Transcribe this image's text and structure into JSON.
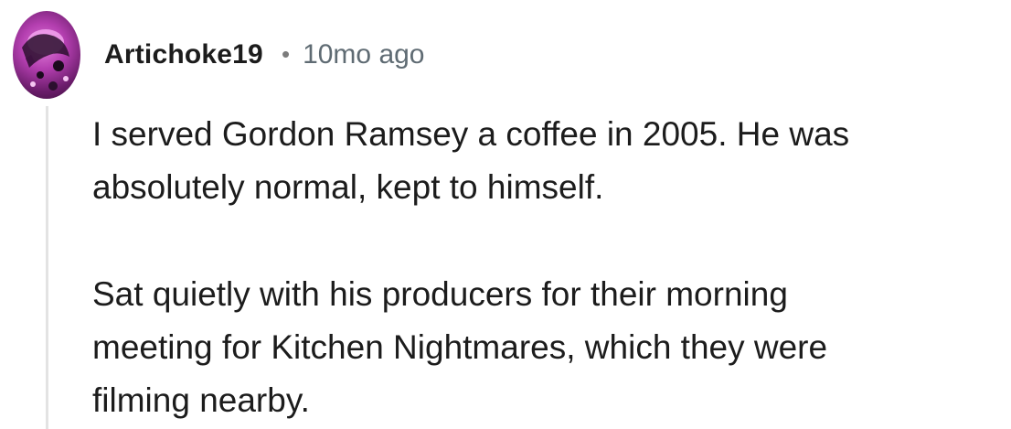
{
  "comment": {
    "author": "Artichoke19",
    "separator": "•",
    "timestamp": "10mo ago",
    "paragraphs": [
      {
        "lines": [
          "I served Gordon Ramsey a coffee in 2005. He was",
          "absolutely normal, kept to himself."
        ]
      },
      {
        "lines": [
          "Sat quietly with his producers for their morning",
          "meeting for Kitchen Nightmares, which they were",
          "filming nearby."
        ]
      }
    ]
  },
  "colors": {
    "text": "#1c1c1c",
    "meta": "#5f6b73",
    "thread_line": "#e3e3e3",
    "avatar_accent": "#b43fb0"
  },
  "icons": {
    "avatar": "user-avatar-image"
  }
}
